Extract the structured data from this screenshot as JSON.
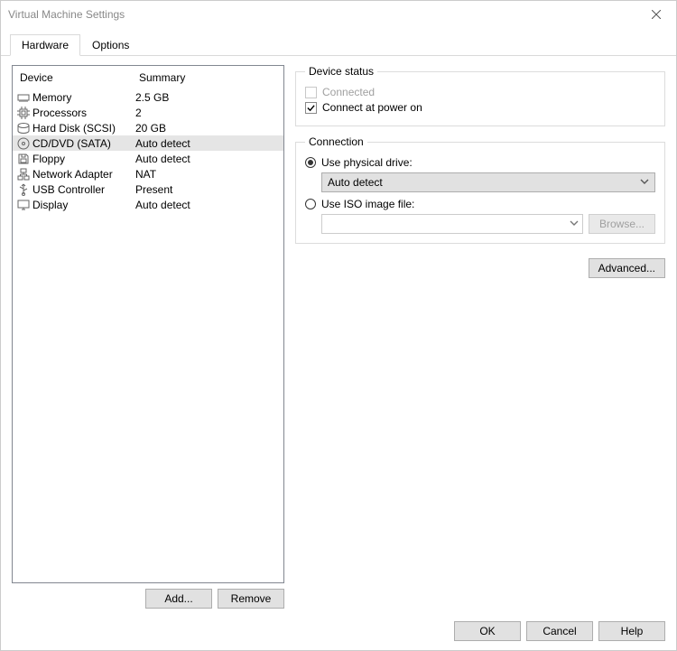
{
  "window": {
    "title": "Virtual Machine Settings"
  },
  "tabs": {
    "hardware": "Hardware",
    "options": "Options"
  },
  "table": {
    "headers": {
      "device": "Device",
      "summary": "Summary"
    }
  },
  "devices": [
    {
      "name": "Memory",
      "summary": "2.5 GB",
      "icon": "memory-icon"
    },
    {
      "name": "Processors",
      "summary": "2",
      "icon": "cpu-icon"
    },
    {
      "name": "Hard Disk (SCSI)",
      "summary": "20 GB",
      "icon": "disk-icon"
    },
    {
      "name": "CD/DVD (SATA)",
      "summary": "Auto detect",
      "icon": "cd-icon",
      "selected": true
    },
    {
      "name": "Floppy",
      "summary": "Auto detect",
      "icon": "floppy-icon"
    },
    {
      "name": "Network Adapter",
      "summary": "NAT",
      "icon": "network-icon"
    },
    {
      "name": "USB Controller",
      "summary": "Present",
      "icon": "usb-icon"
    },
    {
      "name": "Display",
      "summary": "Auto detect",
      "icon": "display-icon"
    }
  ],
  "leftButtons": {
    "add": "Add...",
    "remove": "Remove"
  },
  "deviceStatus": {
    "legend": "Device status",
    "connected": "Connected",
    "connectAtPowerOn": "Connect at power on"
  },
  "connection": {
    "legend": "Connection",
    "usePhysical": "Use physical drive:",
    "physicalValue": "Auto detect",
    "useIso": "Use ISO image file:",
    "browse": "Browse..."
  },
  "advanced": "Advanced...",
  "bottom": {
    "ok": "OK",
    "cancel": "Cancel",
    "help": "Help"
  }
}
